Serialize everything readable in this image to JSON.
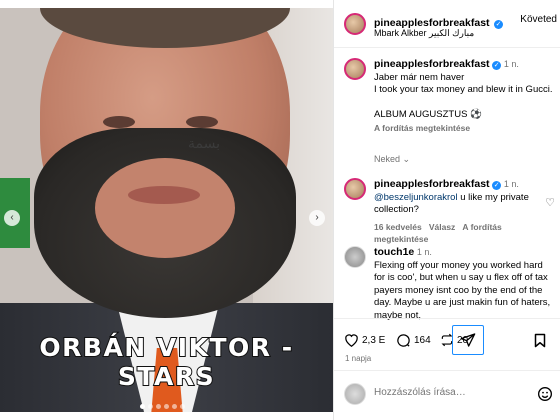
{
  "post": {
    "caption_overlay": "ORBÁN VIKTOR - STARS",
    "tattoo_text": "بسمة"
  },
  "header": {
    "username": "pineapplesforbreakfast",
    "verified_mark": "✓",
    "follow_label": "Követed",
    "subtitle": "Mbark Alkber مبارك الكبير"
  },
  "caption": {
    "username": "pineapplesforbreakfast",
    "age": "1 n.",
    "lines": [
      "Jaber már nem haver",
      "I took your tax money and blew it in Gucci.",
      "",
      "ALBUM AUGUSZTUS ⚽"
    ],
    "translate": "A fordítás megtekintése"
  },
  "comments": [
    {
      "username": "pineapplesforbreakfast",
      "age": "1 n.",
      "mention": "@beszeljunkorakrol",
      "text": " u like my private collection?",
      "likes": "16 kedvelés",
      "reply": "Válasz",
      "translate": "A fordítás megtekintése"
    },
    {
      "username": "touch1e",
      "age": "1 n.",
      "text": "Flexing off your money you worked hard for is coo', but when u say u flex off of tax payers money isnt coo by the end of the day. Maybe u are just makin fun of haters, maybe not,"
    }
  ],
  "actions": {
    "likes": "2,3 E",
    "comments": "164",
    "reposts": "20",
    "posted": "1 napja"
  },
  "compose": {
    "placeholder": "Hozzászólás írása…"
  },
  "colors": {
    "verified": "#1a8cff",
    "share_highlight": "#1a8cff",
    "tie": "#e05a1e"
  }
}
